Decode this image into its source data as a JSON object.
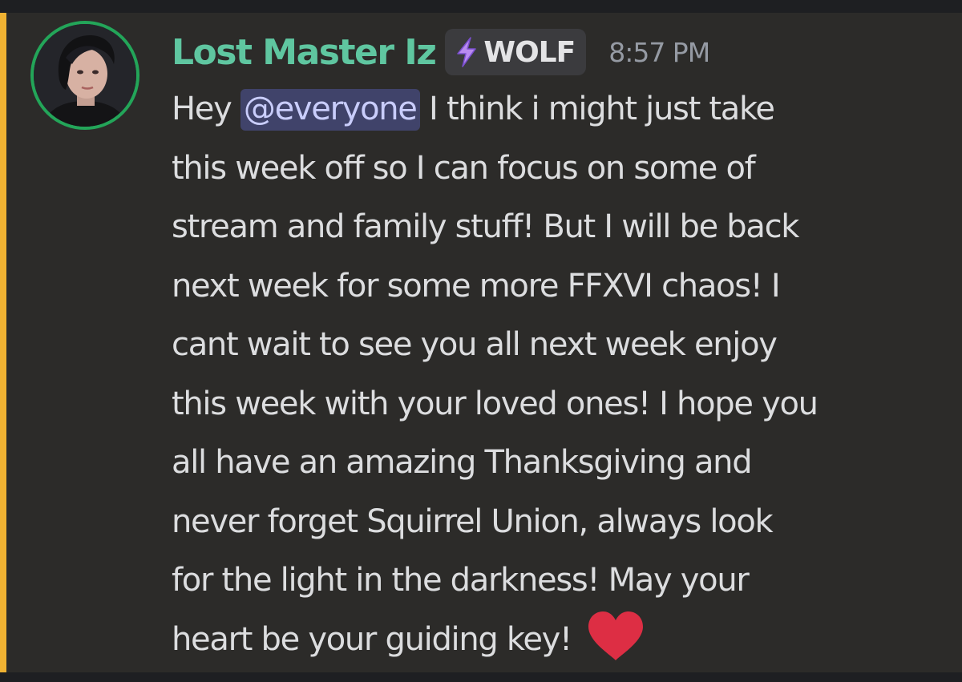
{
  "message": {
    "username": "Lost Master Iz",
    "role_tag": {
      "icon": "lightning-bolt-icon",
      "label": "WOLF"
    },
    "timestamp": "8:57 PM",
    "content_lines": [
      {
        "before": "Hey ",
        "mention": "@everyone",
        "after": " I think i might just take"
      },
      {
        "text": "this week off so I can focus on some of"
      },
      {
        "text": "stream and family stuff! But I will be back"
      },
      {
        "text": "next week for some more FFXVI chaos!  I"
      },
      {
        "text": "cant wait to see you all next week enjoy"
      },
      {
        "text": "this week with your loved ones! I hope you"
      },
      {
        "text": "all have an amazing Thanksgiving and"
      },
      {
        "text": "never forget Squirrel Union, always look"
      },
      {
        "text": "for the light in the darkness! May your"
      },
      {
        "text": "heart be your guiding key! ",
        "emoji": "red-heart-emoji"
      }
    ]
  },
  "colors": {
    "username": "#5fc6a0",
    "mention_bar": "#f0b232",
    "mention_bg": "#40436a",
    "avatar_ring": "#23a559",
    "message_bg": "#2c2b29"
  }
}
